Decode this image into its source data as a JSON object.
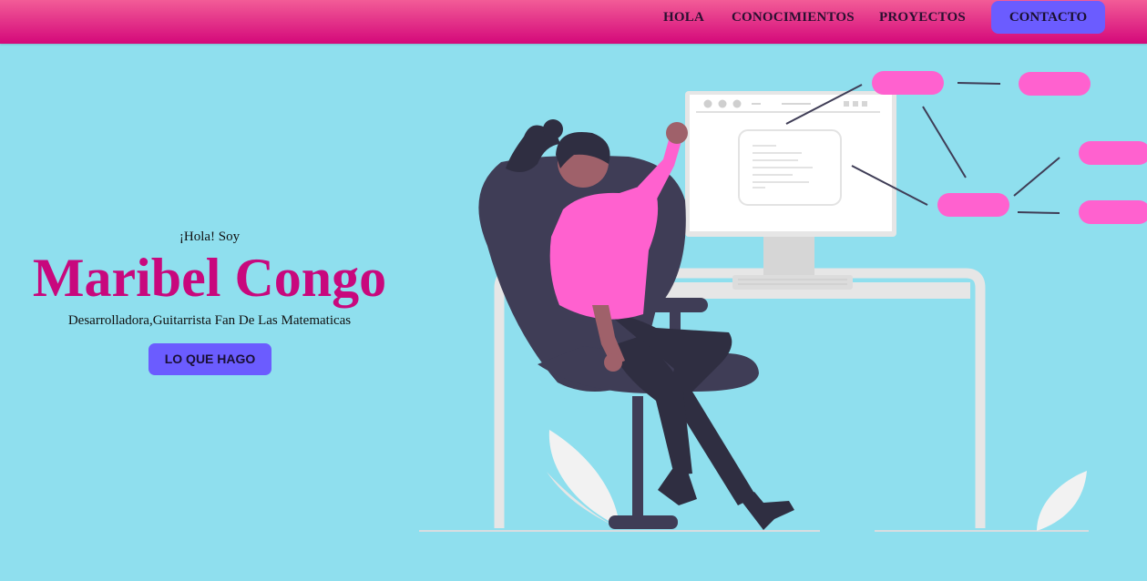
{
  "nav": {
    "items": [
      {
        "label": "HOLA"
      },
      {
        "label": "CONOCIMIENTOS"
      },
      {
        "label": "PROYECTOS"
      }
    ],
    "contact_label": "CONTACTO"
  },
  "hero": {
    "greeting": "¡Hola! Soy",
    "name": "Maribel Congo",
    "subtitle": "Desarrolladora,Guitarrista Fan De Las Matematicas",
    "cta_label": "LO QUE HAGO"
  },
  "colors": {
    "background": "#8fdfee",
    "navbar_gradient_top": "#f25c97",
    "navbar_gradient_bottom": "#d4087a",
    "button": "#6b5cff",
    "name": "#c8087d",
    "pink_accent": "#ff61cf",
    "chair": "#3f3d56"
  }
}
